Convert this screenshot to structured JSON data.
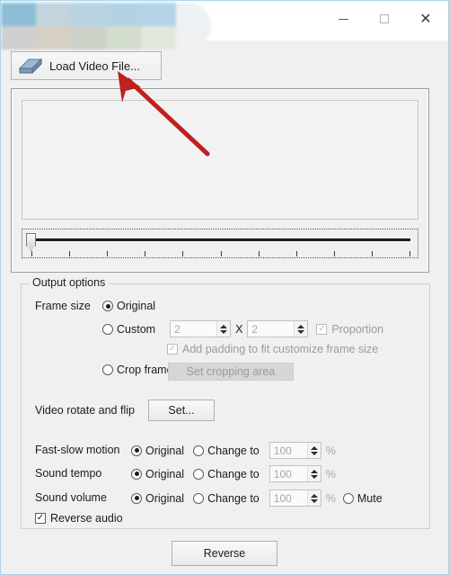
{
  "window": {
    "title": "",
    "title_redacted": true,
    "border_color": "#a9d5e8",
    "background": "#f0f0f0",
    "controls": {
      "minimize": "—",
      "maximize": "□",
      "close": "✕"
    }
  },
  "toolbar": {
    "load_button_label": "Load Video File...",
    "load_button_icon": "folder-video-icon"
  },
  "preview": {
    "slider": {
      "position_percent": 0,
      "tick_count": 11
    }
  },
  "annotation": {
    "arrow_color": "#c0201f",
    "points_to": "load-video-file-button"
  },
  "output_options": {
    "legend": "Output options",
    "frame_size": {
      "label": "Frame size",
      "original": {
        "label": "Original",
        "selected": true
      },
      "custom": {
        "label": "Custom",
        "selected": false
      },
      "width_value": "2",
      "separator": "X",
      "height_value": "2",
      "proportion": {
        "label": "Proportion",
        "checked": true,
        "enabled": false
      },
      "padding": {
        "label": "Add padding to fit customize frame size",
        "checked": true,
        "enabled": false
      },
      "crop_frame": {
        "label": "Crop frame",
        "selected": false
      },
      "crop_button": {
        "label": "Set cropping area",
        "enabled": false
      }
    },
    "rotate_flip": {
      "label": "Video rotate and flip",
      "button_label": "Set..."
    },
    "controls": [
      {
        "label": "Fast-slow motion",
        "original_label": "Original",
        "original_selected": true,
        "change_label": "Change to",
        "change_selected": false,
        "value": "100",
        "unit": "%"
      },
      {
        "label": "Sound tempo",
        "original_label": "Original",
        "original_selected": true,
        "change_label": "Change to",
        "change_selected": false,
        "value": "100",
        "unit": "%"
      },
      {
        "label": "Sound volume",
        "original_label": "Original",
        "original_selected": true,
        "change_label": "Change to",
        "change_selected": false,
        "value": "100",
        "unit": "%",
        "mute_label": "Mute",
        "mute_selected": false
      }
    ],
    "reverse_audio": {
      "label": "Reverse audio",
      "checked": true
    }
  },
  "footer": {
    "reverse_button_label": "Reverse"
  }
}
